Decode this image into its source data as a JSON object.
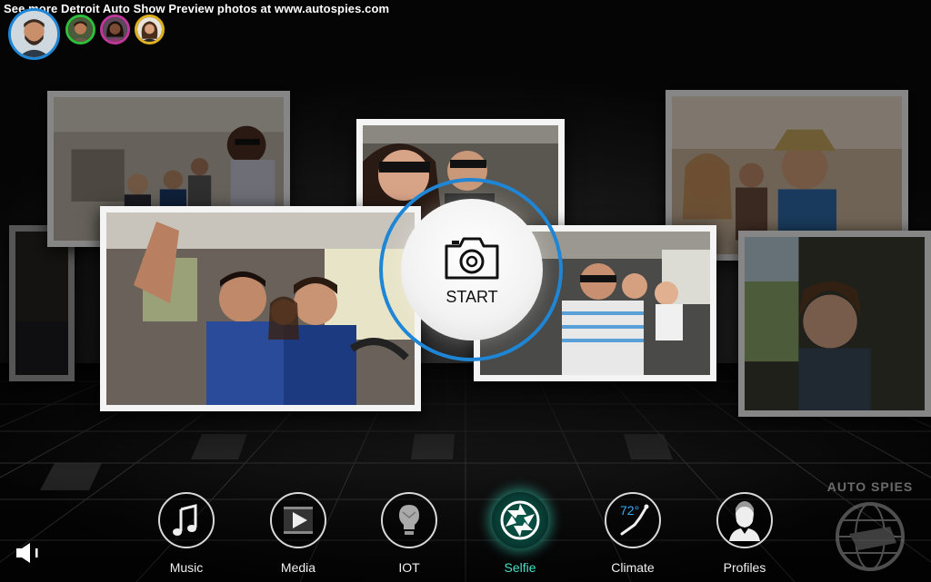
{
  "watermark": "See more Detroit Auto Show Preview photos at www.autospies.com",
  "profiles": [
    {
      "name": "profile-avatar-main",
      "ring": "#1f86d6",
      "skin": "#c98e6a",
      "hair": "#3a2a20"
    },
    {
      "name": "profile-avatar-2",
      "ring": "#2fbf3a",
      "skin": "#b87a55",
      "hair": "#2a1a10"
    },
    {
      "name": "profile-avatar-3",
      "ring": "#c0399a",
      "skin": "#7a4c36",
      "hair": "#1b0f0a"
    },
    {
      "name": "profile-avatar-4",
      "ring": "#e0b020",
      "skin": "#d9a07c",
      "hair": "#4a2e1a"
    }
  ],
  "start": {
    "label": "START",
    "ring_color": "#1f86d6",
    "icon": "camera-icon"
  },
  "nav": [
    {
      "id": "music",
      "label": "Music",
      "icon": "music-note-icon",
      "active": false
    },
    {
      "id": "media",
      "label": "Media",
      "icon": "play-media-icon",
      "active": false
    },
    {
      "id": "iot",
      "label": "IOT",
      "icon": "lightbulb-icon",
      "active": false
    },
    {
      "id": "selfie",
      "label": "Selfie",
      "icon": "camera-aperture-icon",
      "active": true
    },
    {
      "id": "climate",
      "label": "Climate",
      "icon": "climate-seat-icon",
      "active": false,
      "temperature": "72°"
    },
    {
      "id": "profiles",
      "label": "Profiles",
      "icon": "person-profile-icon",
      "active": false
    }
  ],
  "colors": {
    "accent_blue": "#1f86d6",
    "active_teal": "#48e0c6",
    "photo_frame": "#f4f4f4"
  },
  "logo": {
    "text": "AUTO SPIES",
    "icon": "globe-logo-icon"
  },
  "volume": {
    "icon": "speaker-icon"
  }
}
